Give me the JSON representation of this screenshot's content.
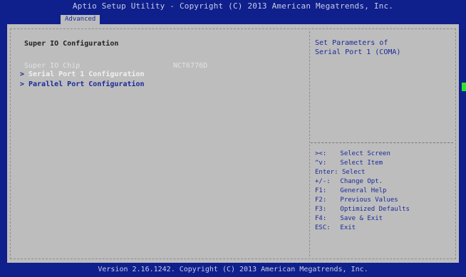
{
  "header": {
    "title": "Aptio Setup Utility - Copyright (C) 2013 American Megatrends, Inc.",
    "active_tab": "Advanced"
  },
  "main": {
    "section_title": "Super IO Configuration",
    "chip_label": "Super IO Chip",
    "chip_value": "NCT6776D",
    "items": [
      {
        "arrow": ">",
        "label": "Serial Port 1 Configuration",
        "selected": true
      },
      {
        "arrow": ">",
        "label": "Parallel Port Configuration",
        "selected": false
      }
    ]
  },
  "help": {
    "text": "Set Parameters of\nSerial Port 1 (COMA)"
  },
  "keys": [
    {
      "key": "><:",
      "desc": "Select Screen"
    },
    {
      "key": "^v:",
      "desc": "Select Item"
    },
    {
      "key": "Enter:",
      "desc": "Select"
    },
    {
      "key": "+/-:",
      "desc": "Change Opt."
    },
    {
      "key": "F1:",
      "desc": "General Help"
    },
    {
      "key": "F2:",
      "desc": "Previous Values"
    },
    {
      "key": "F3:",
      "desc": "Optimized Defaults"
    },
    {
      "key": "F4:",
      "desc": "Save & Exit"
    },
    {
      "key": "ESC:",
      "desc": "Exit"
    }
  ],
  "footer": {
    "text": "Version 2.16.1242. Copyright (C) 2013 American Megatrends, Inc."
  },
  "colors": {
    "blue_frame": "#0f1f8c",
    "panel_gray": "#bdbdbd",
    "text_blue": "#1a2a9a",
    "highlight_white": "#f0f0f0",
    "green_indicator": "#2fe12f"
  }
}
